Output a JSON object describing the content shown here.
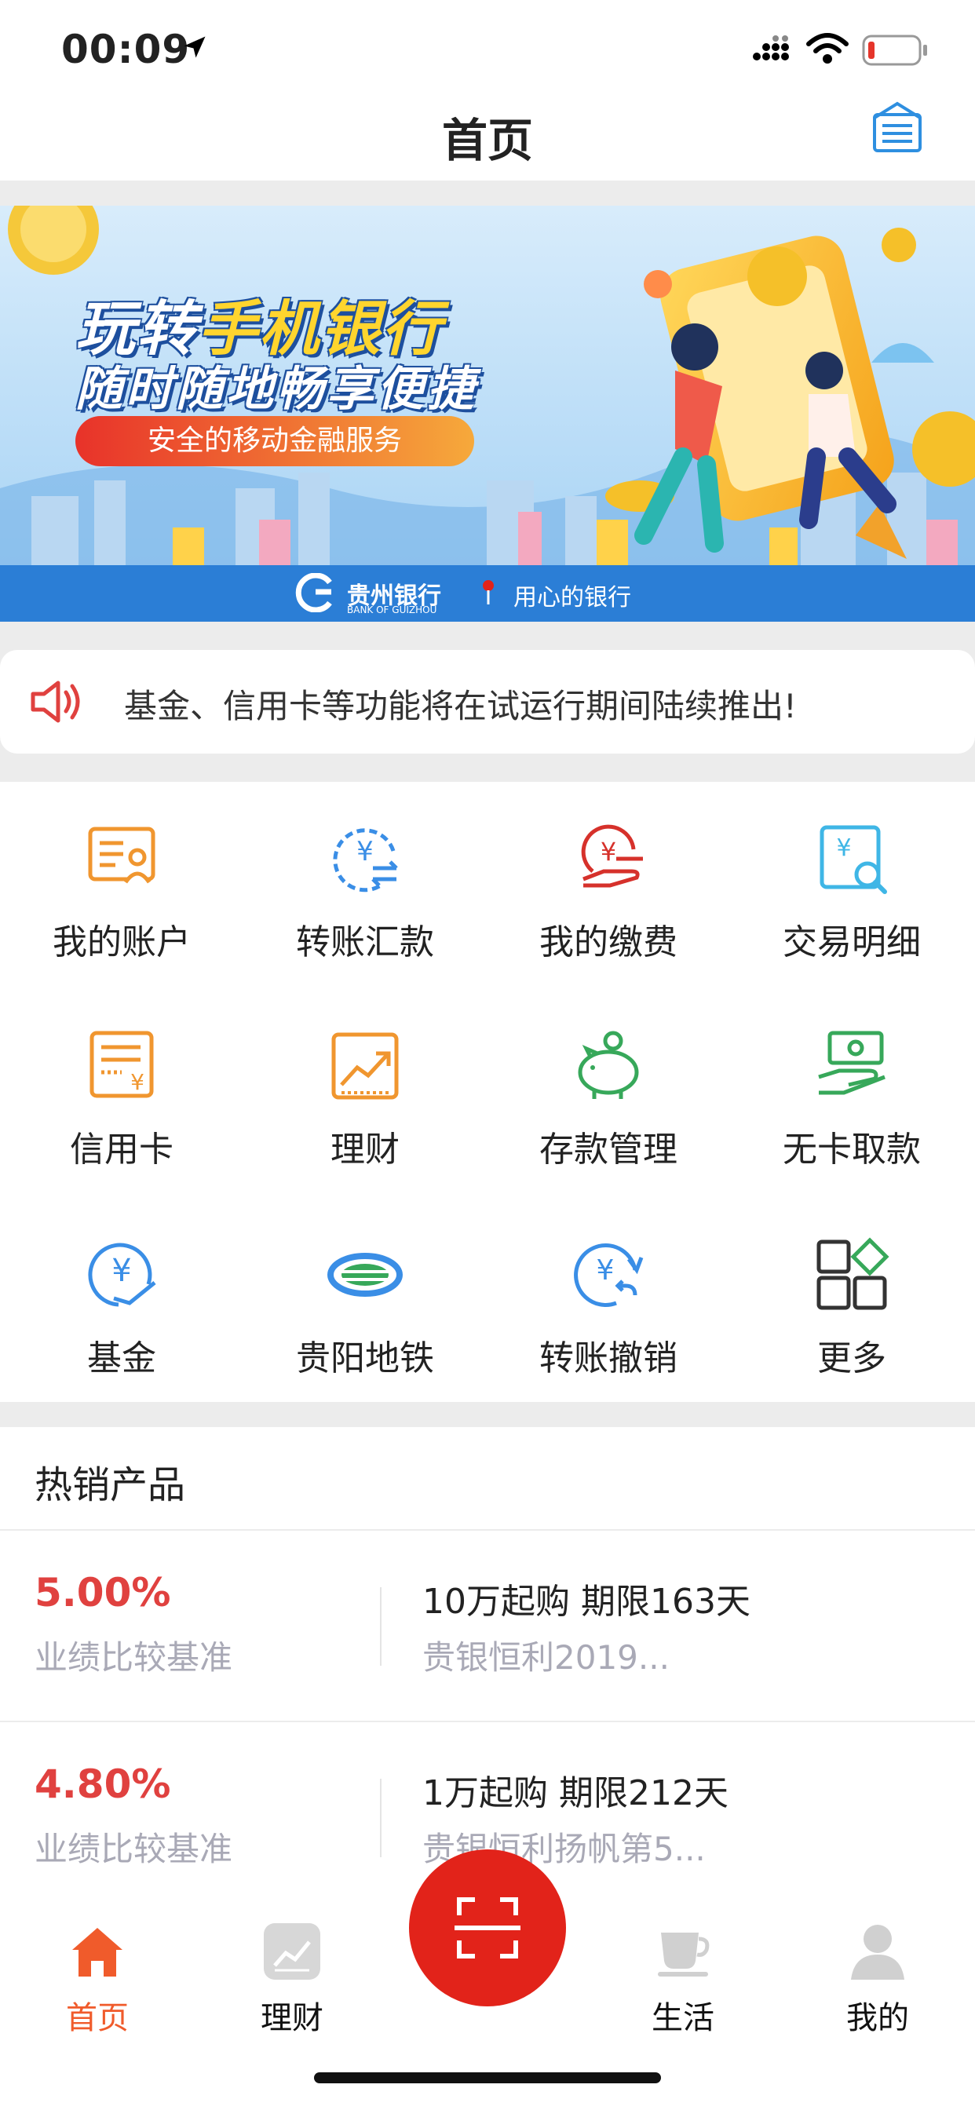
{
  "status_bar": {
    "time": "00:09"
  },
  "nav": {
    "title": "首页"
  },
  "banner": {
    "line1_part1": "玩转",
    "line1_part2": "手机银行",
    "line2": "随时随地畅享便捷",
    "pill": "安全的移动金融服务",
    "bank_name": "贵州银行",
    "bank_en": "BANK OF GUIZHOU",
    "slogan": "用心的银行"
  },
  "notice": {
    "text": "基金、信用卡等功能将在试运行期间陆续推出!"
  },
  "grid": {
    "items": [
      {
        "label": "我的账户",
        "icon": "account-icon",
        "color": "#f0962f"
      },
      {
        "label": "转账汇款",
        "icon": "transfer-icon",
        "color": "#3a8ee6"
      },
      {
        "label": "我的缴费",
        "icon": "payment-icon",
        "color": "#d6312b"
      },
      {
        "label": "交易明细",
        "icon": "transaction-detail-icon",
        "color": "#3fb6e6"
      },
      {
        "label": "信用卡",
        "icon": "credit-card-icon",
        "color": "#f0962f"
      },
      {
        "label": "理财",
        "icon": "wealth-chart-icon",
        "color": "#f0962f"
      },
      {
        "label": "存款管理",
        "icon": "piggy-bank-icon",
        "color": "#37a85a"
      },
      {
        "label": "无卡取款",
        "icon": "cardless-withdraw-icon",
        "color": "#37a85a"
      },
      {
        "label": "基金",
        "icon": "fund-icon",
        "color": "#3a8ee6"
      },
      {
        "label": "贵阳地铁",
        "icon": "metro-icon",
        "color": "#3a8ee6"
      },
      {
        "label": "转账撤销",
        "icon": "transfer-cancel-icon",
        "color": "#3a8ee6"
      },
      {
        "label": "更多",
        "icon": "more-grid-icon",
        "color": "#333333"
      }
    ]
  },
  "hot": {
    "title": "热销产品",
    "products": [
      {
        "rate": "5.00%",
        "rate_label": "业绩比较基准",
        "summary": "10万起购 期限163天",
        "name": "贵银恒利2019..."
      },
      {
        "rate": "4.80%",
        "rate_label": "业绩比较基准",
        "summary": "1万起购 期限212天",
        "name": "贵银恒利扬帆第5..."
      }
    ]
  },
  "tabbar": {
    "tabs": [
      {
        "label": "首页",
        "icon": "home-icon"
      },
      {
        "label": "理财",
        "icon": "wealth-icon"
      },
      {
        "label": "生活",
        "icon": "coffee-cup-icon"
      },
      {
        "label": "我的",
        "icon": "profile-icon"
      }
    ],
    "scan_icon": "scan-icon"
  },
  "colors": {
    "accent_red": "#e2231a",
    "active_tab": "#f05b2b",
    "rate_red": "#e0413f",
    "banner_blue": "#2b7ed6"
  }
}
